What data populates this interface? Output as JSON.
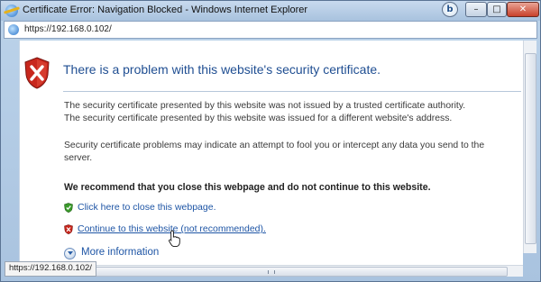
{
  "window": {
    "title": "Certificate Error: Navigation Blocked - Windows Internet Explorer",
    "controls": {
      "bing": "b",
      "minimize": "–",
      "maximize": "□",
      "close": "✕"
    }
  },
  "address_bar": {
    "url": "https://192.168.0.102/"
  },
  "page": {
    "heading": "There is a problem with this website's security certificate.",
    "paragraph_1": "The security certificate presented by this website was not issued by a trusted certificate authority.",
    "paragraph_2": "The security certificate presented by this website was issued for a different website's address.",
    "paragraph_3": "Security certificate problems may indicate an attempt to fool you or intercept any data you send to the server.",
    "recommendation": "We recommend that you close this webpage and do not continue to this website.",
    "close_link": "Click here to close this webpage.",
    "continue_link": "Continue to this website (not recommended).",
    "more_info": "More information"
  },
  "status_bar": {
    "text": "https://192.168.0.102/"
  },
  "colors": {
    "heading": "#1f4e92",
    "link": "#1e55a5",
    "shield_red": "#c8271d",
    "shield_green": "#3a9a2b"
  },
  "icons": [
    "shield-error-icon",
    "shield-green-icon",
    "shield-red-icon",
    "expand-circle-icon",
    "hand-cursor-icon",
    "ie-icon"
  ]
}
